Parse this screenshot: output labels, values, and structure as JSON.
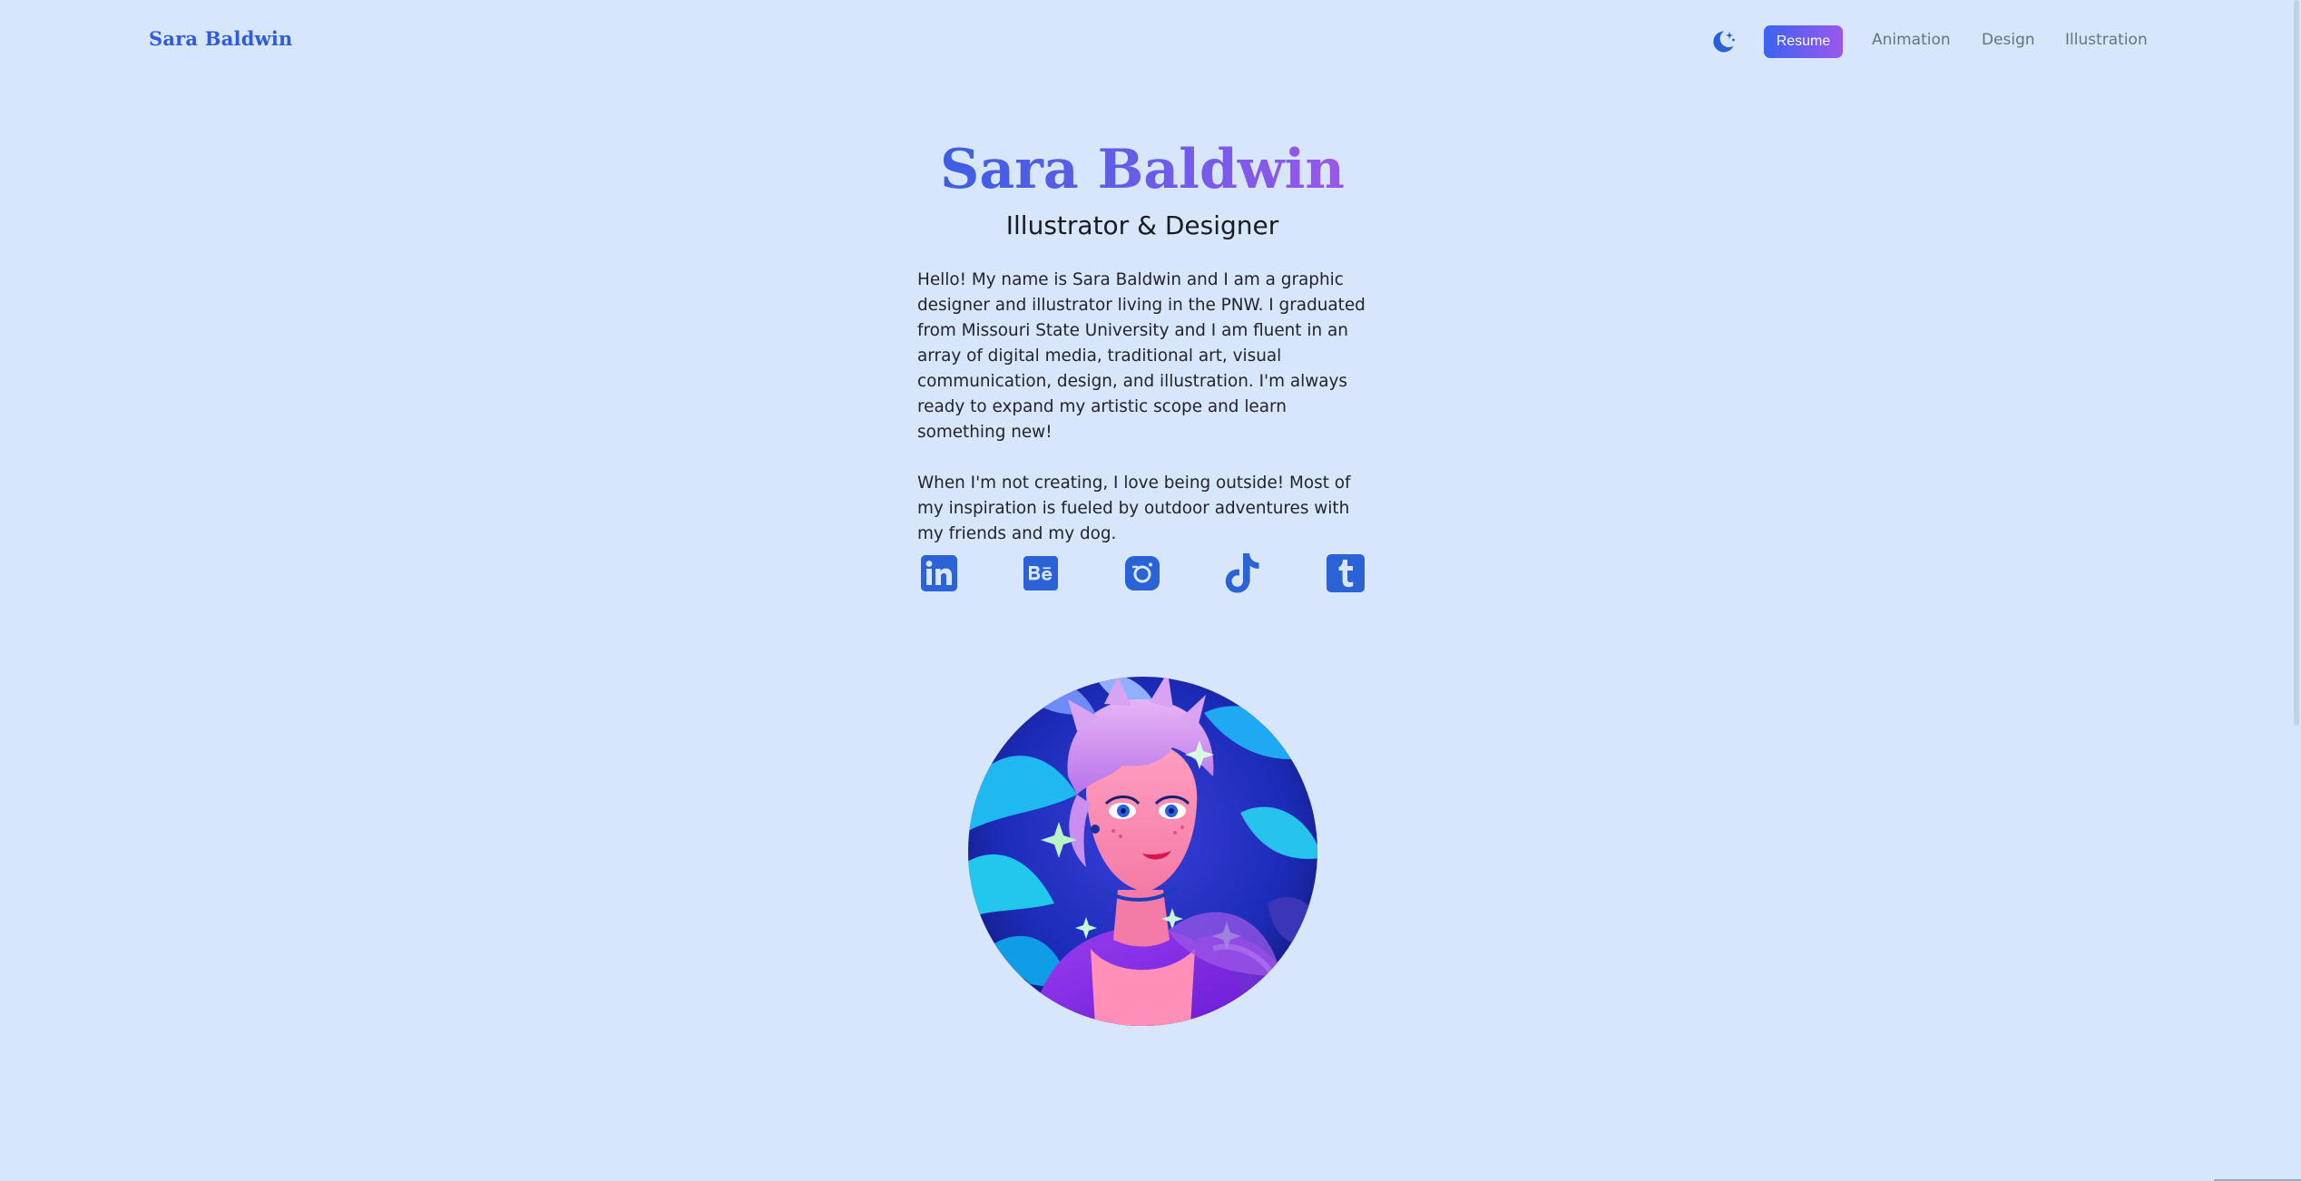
{
  "header": {
    "brand": "Sara Baldwin",
    "theme_toggle_icon": "moon-stars-icon",
    "resume_label": "Resume",
    "nav": [
      "Animation",
      "Design",
      "Illustration"
    ]
  },
  "hero": {
    "title": "Sara Baldwin",
    "subtitle": "Illustrator & Designer",
    "bio_paragraphs": [
      "Hello! My name is Sara Baldwin and I am a graphic designer and illustrator living in the PNW. I graduated from Missouri State University and I am fluent in an array of digital media, traditional art, visual communication, design, and illustration. I'm always ready to expand my artistic scope and learn something new!",
      "When I'm not creating, I love being outside! Most of my inspiration is fueled by outdoor adventures with my friends and my dog."
    ]
  },
  "social": [
    {
      "icon": "linkedin-icon"
    },
    {
      "icon": "behance-icon"
    },
    {
      "icon": "instagram-icon"
    },
    {
      "icon": "tiktok-icon"
    },
    {
      "icon": "tumblr-icon"
    }
  ],
  "colors": {
    "background": "#d7e6fb",
    "accent_blue": "#2f5bdc",
    "icon_blue": "#2b63d6",
    "gradient_start": "#3b5fe2",
    "gradient_end": "#9a57ea"
  }
}
